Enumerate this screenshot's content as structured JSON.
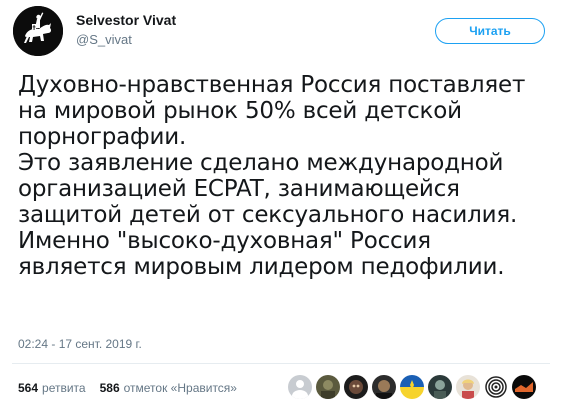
{
  "author": {
    "name": "Selvestor Vivat",
    "handle": "@S_vivat"
  },
  "follow_label": "Читать",
  "tweet_lines": [
    "Духовно-нравственная Россия поставляет",
    "на мировой рынок 50% всей детской",
    "порнографии.",
    "Это заявление сделано международной",
    "организацией ECPAT, занимающейся",
    "защитой детей от сексуального насилия.",
    "Именно \"высоко-духовная\" Россия",
    "является мировым лидером педофилии."
  ],
  "timestamp": "02:24 - 17 сент. 2019 г.",
  "stats": {
    "retweets_count": "564",
    "retweets_label": "ретвита",
    "likes_count": "586",
    "likes_label": "отметок «Нравится»"
  },
  "likers": [
    {
      "icon": "profile-avatar-1"
    },
    {
      "icon": "profile-avatar-2"
    },
    {
      "icon": "profile-avatar-3"
    },
    {
      "icon": "profile-avatar-4"
    },
    {
      "icon": "profile-avatar-5"
    },
    {
      "icon": "profile-avatar-6"
    },
    {
      "icon": "profile-avatar-7"
    },
    {
      "icon": "profile-avatar-8"
    },
    {
      "icon": "profile-avatar-9"
    }
  ],
  "colors": {
    "accent": "#1da1f2",
    "text": "#14171a",
    "muted": "#657786",
    "divider": "#e6ecf0"
  }
}
